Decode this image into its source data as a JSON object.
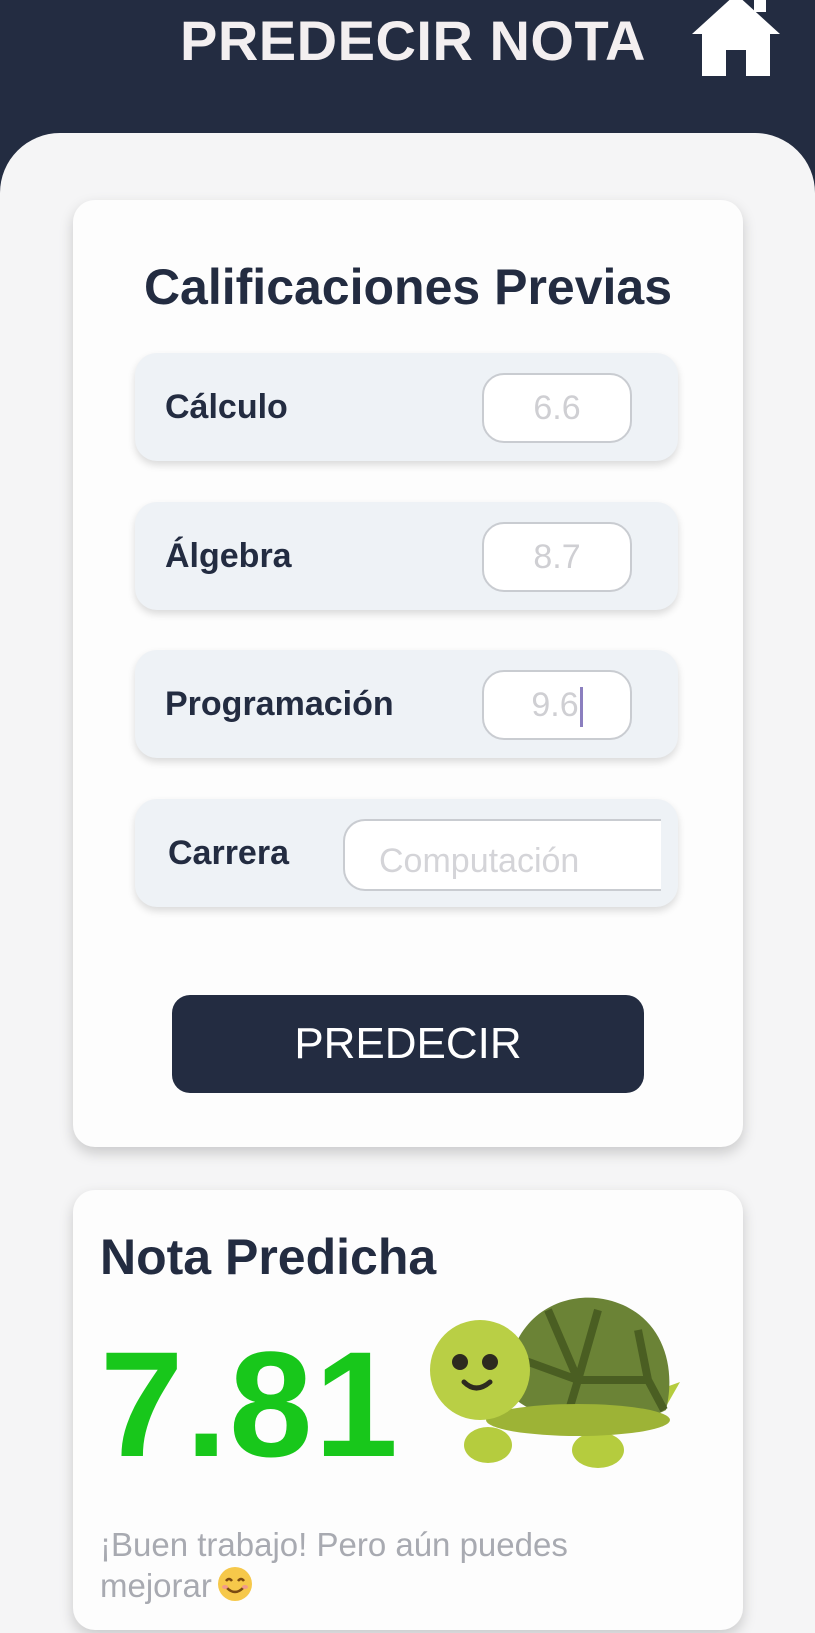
{
  "header": {
    "title": "PREDECIR NOTA",
    "home_icon": "home-icon"
  },
  "grades_card": {
    "title": "Calificaciones Previas",
    "fields": [
      {
        "label": "Cálculo",
        "value": "6.6"
      },
      {
        "label": "Álgebra",
        "value": "8.7"
      },
      {
        "label": "Programación",
        "value": "9.6"
      }
    ],
    "career": {
      "label": "Carrera",
      "placeholder": "Computación"
    },
    "predict_label": "PREDECIR"
  },
  "result_card": {
    "title": "Nota Predicha",
    "value": "7.81",
    "message": "¡Buen trabajo! Pero aún puedes mejorar",
    "mascot": "turtle-icon",
    "message_emoji": "smiling-face-icon"
  },
  "colors": {
    "header_bg": "#232c41",
    "accent": "#232c41",
    "score": "#18c71b"
  }
}
